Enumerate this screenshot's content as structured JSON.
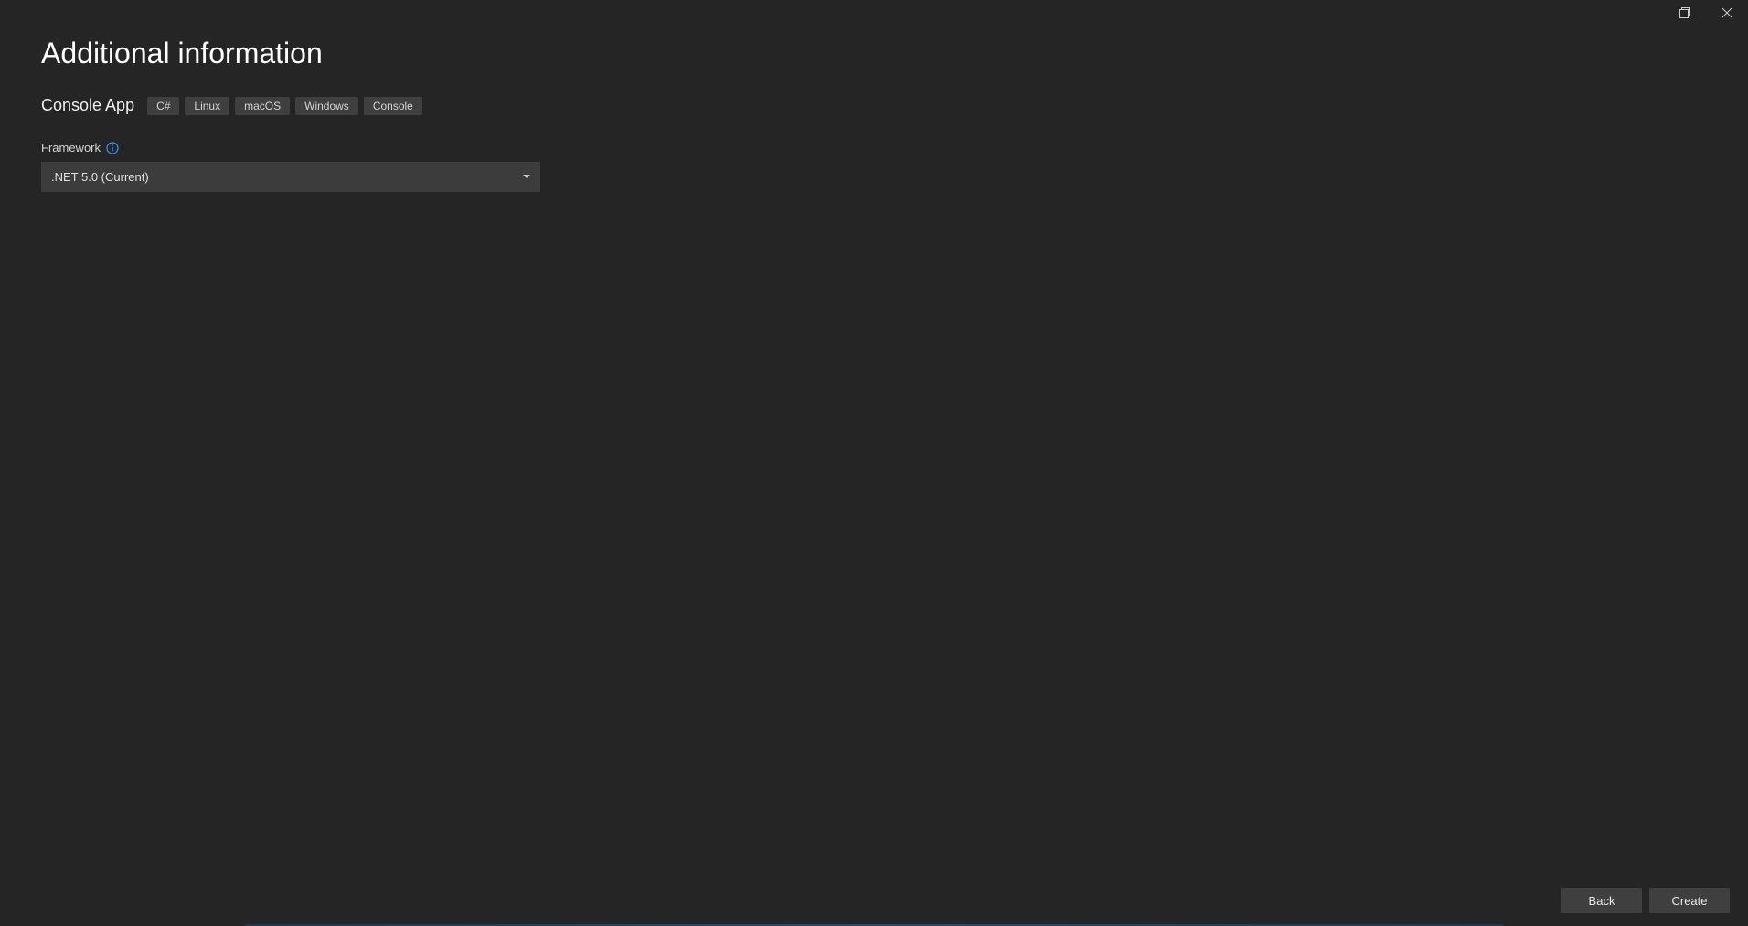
{
  "page": {
    "title": "Additional information",
    "subtitle": "Console App",
    "tags": [
      "C#",
      "Linux",
      "macOS",
      "Windows",
      "Console"
    ]
  },
  "framework": {
    "label": "Framework",
    "selected": ".NET 5.0 (Current)"
  },
  "footer": {
    "back": "Back",
    "create": "Create"
  }
}
